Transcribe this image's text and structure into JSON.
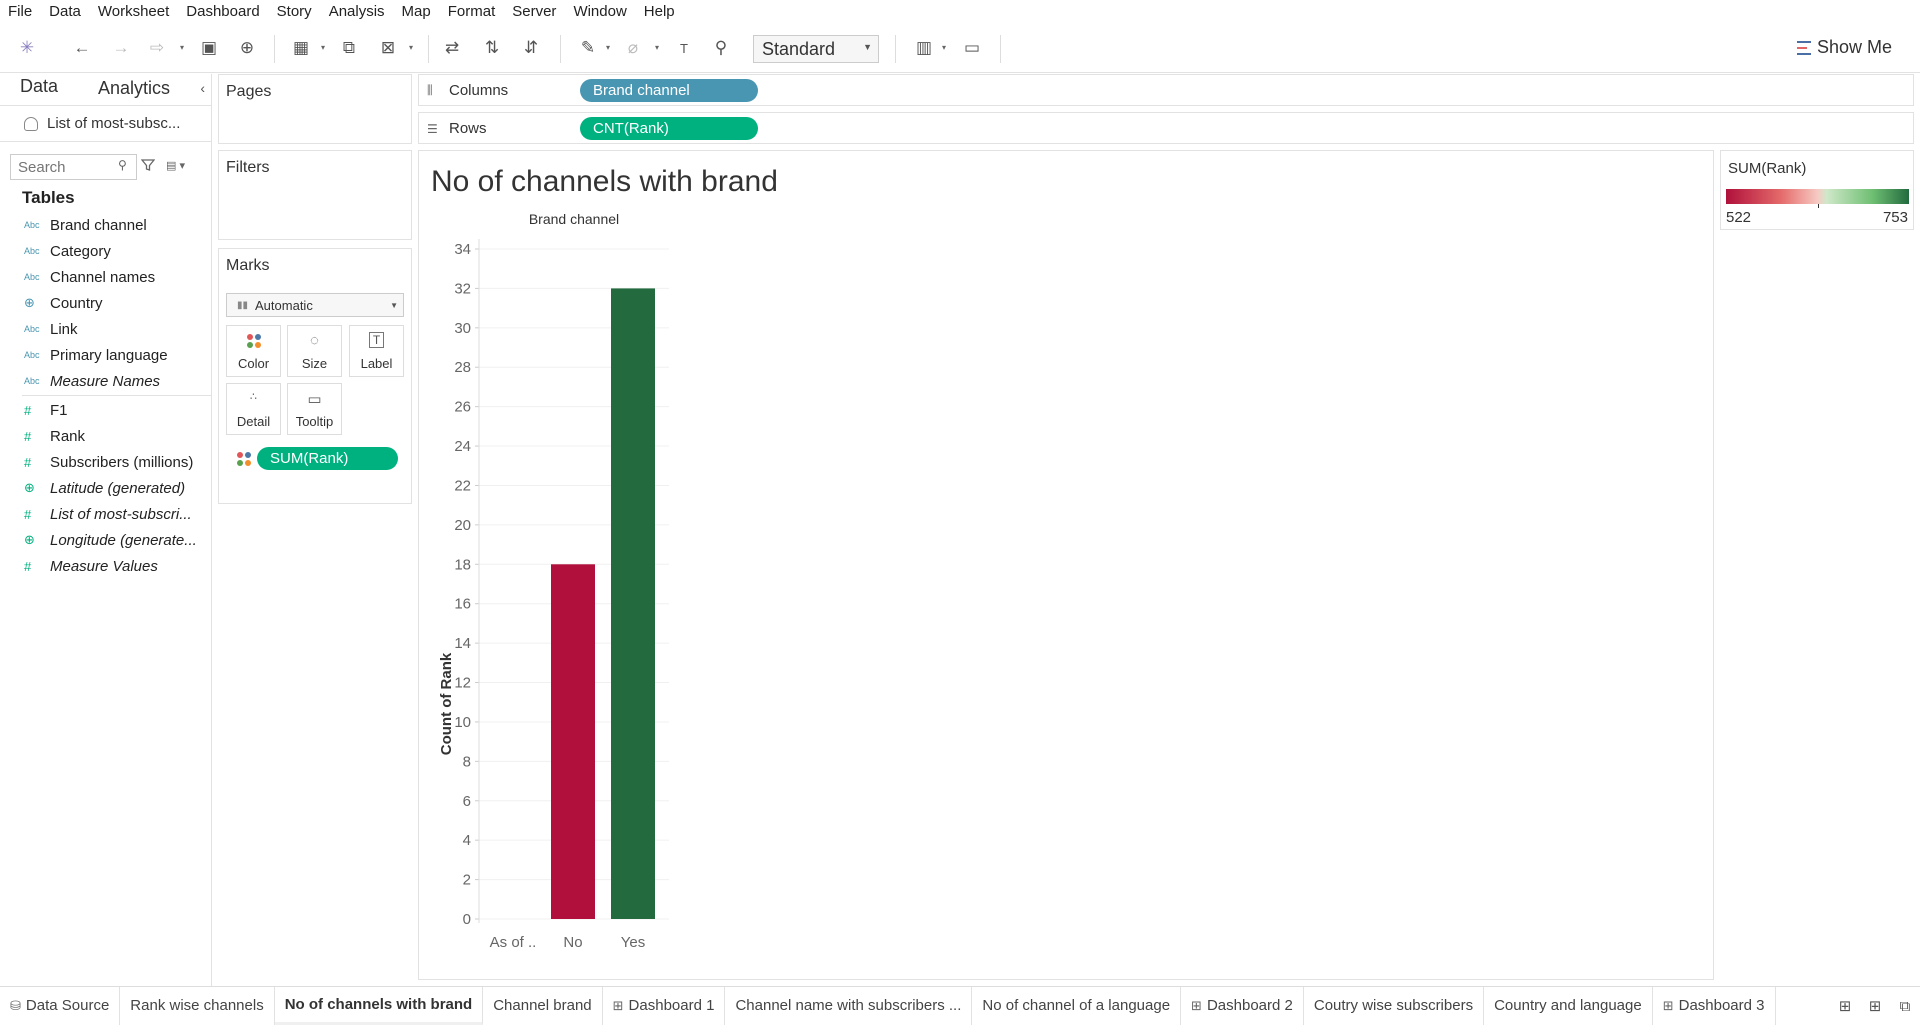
{
  "menu": [
    "File",
    "Data",
    "Worksheet",
    "Dashboard",
    "Story",
    "Analysis",
    "Map",
    "Format",
    "Server",
    "Window",
    "Help"
  ],
  "toolbar": {
    "fit": "Standard",
    "show_me": "Show Me"
  },
  "data_pane": {
    "tabs": [
      "Data",
      "Analytics"
    ],
    "datasource": "List of most-subsc...",
    "search_placeholder": "Search",
    "tables_heading": "Tables",
    "dimensions": [
      {
        "type": "Abc",
        "name": "Brand channel"
      },
      {
        "type": "Abc",
        "name": "Category"
      },
      {
        "type": "Abc",
        "name": "Channel names"
      },
      {
        "type": "globe",
        "name": "Country"
      },
      {
        "type": "Abc",
        "name": "Link"
      },
      {
        "type": "Abc",
        "name": "Primary language"
      },
      {
        "type": "Abc",
        "name": "Measure Names"
      }
    ],
    "measures": [
      {
        "type": "#",
        "name": "F1"
      },
      {
        "type": "#",
        "name": "Rank"
      },
      {
        "type": "#",
        "name": "Subscribers (millions)"
      },
      {
        "type": "globe",
        "name": "Latitude (generated)"
      },
      {
        "type": "#",
        "name": "List of most-subscri..."
      },
      {
        "type": "globe",
        "name": "Longitude (generate..."
      },
      {
        "type": "#",
        "name": "Measure Values"
      }
    ]
  },
  "cards": {
    "pages": "Pages",
    "filters": "Filters",
    "marks": "Marks",
    "mark_type": "Automatic",
    "buttons": [
      "Color",
      "Size",
      "Label",
      "Detail",
      "Tooltip"
    ],
    "color_pill": "SUM(Rank)"
  },
  "shelves": {
    "columns_label": "Columns",
    "columns_pill": "Brand channel",
    "rows_label": "Rows",
    "rows_pill": "CNT(Rank)"
  },
  "sheet_title": "No of channels with brand",
  "legend": {
    "title": "SUM(Rank)",
    "min": "522",
    "max": "753",
    "colors": {
      "low": "#b0103b",
      "high": "#236b3f"
    }
  },
  "chart_data": {
    "type": "bar",
    "column_header": "Brand channel",
    "categories": [
      "As of ..",
      "No",
      "Yes"
    ],
    "values": [
      0,
      18,
      32
    ],
    "colors": [
      "#b0103b",
      "#b0103b",
      "#236b3f"
    ],
    "ylabel": "Count of Rank",
    "ylim": [
      0,
      34
    ],
    "yticks": [
      0,
      2,
      4,
      6,
      8,
      10,
      12,
      14,
      16,
      18,
      20,
      22,
      24,
      26,
      28,
      30,
      32,
      34
    ],
    "grid": true
  },
  "sheet_tabs": [
    {
      "label": "Data Source",
      "icon": "db-icon"
    },
    {
      "label": "Rank wise channels"
    },
    {
      "label": "No of channels with brand",
      "active": true
    },
    {
      "label": "Channel brand"
    },
    {
      "label": "Dashboard 1",
      "icon": "dashboard-icon"
    },
    {
      "label": "Channel name with subscribers ..."
    },
    {
      "label": "No of channel of a language"
    },
    {
      "label": "Dashboard 2",
      "icon": "dashboard-icon"
    },
    {
      "label": "Coutry wise subscribers"
    },
    {
      "label": "Country and language"
    },
    {
      "label": "Dashboard 3",
      "icon": "dashboard-icon"
    }
  ]
}
